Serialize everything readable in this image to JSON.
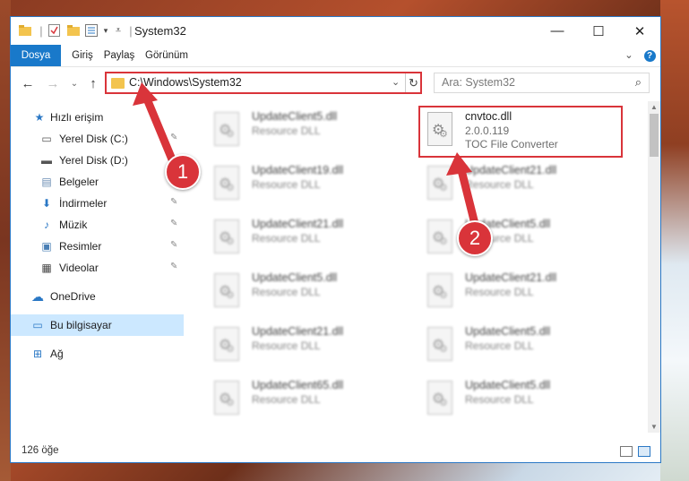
{
  "window": {
    "title": "System32",
    "quick_access_toolbar": [
      "folder-icon",
      "properties-icon",
      "new-folder-icon",
      "customize-icon"
    ],
    "controls": {
      "minimize": "—",
      "maximize": "☐",
      "close": "✕"
    }
  },
  "ribbon": {
    "tabs": [
      "Dosya",
      "Giriş",
      "Paylaş",
      "Görünüm"
    ],
    "expand": "⌄",
    "help": "?"
  },
  "navigation": {
    "back": "←",
    "forward": "→",
    "recent": "⌄",
    "up": "↑",
    "address": "C:\\Windows\\System32",
    "dropdown": "⌄",
    "refresh": "↻",
    "search_placeholder": "Ara: System32",
    "search_icon": "⌕"
  },
  "sidebar": {
    "items": [
      {
        "label": "Hızlı erişim",
        "icon": "star-icon",
        "glyph": "★",
        "pinned": false
      },
      {
        "label": "Yerel Disk (C:)",
        "icon": "drive-icon",
        "glyph": "▭",
        "pinned": true
      },
      {
        "label": "Yerel Disk (D:)",
        "icon": "drive-icon",
        "glyph": "▬",
        "pinned": true
      },
      {
        "label": "Belgeler",
        "icon": "documents-icon",
        "glyph": "▤",
        "pinned": true
      },
      {
        "label": "İndirmeler",
        "icon": "downloads-icon",
        "glyph": "⬇",
        "pinned": true
      },
      {
        "label": "Müzik",
        "icon": "music-icon",
        "glyph": "♪",
        "pinned": true
      },
      {
        "label": "Resimler",
        "icon": "pictures-icon",
        "glyph": "▣",
        "pinned": true
      },
      {
        "label": "Videolar",
        "icon": "videos-icon",
        "glyph": "▦",
        "pinned": true
      },
      {
        "label": "OneDrive",
        "icon": "cloud-icon",
        "glyph": "☁",
        "pinned": false
      },
      {
        "label": "Bu bilgisayar",
        "icon": "computer-icon",
        "glyph": "▭",
        "pinned": false,
        "selected": true
      },
      {
        "label": "Ağ",
        "icon": "network-icon",
        "glyph": "⊞",
        "pinned": false
      }
    ],
    "pin_glyph": "✎"
  },
  "files": [
    {
      "name": "UpdateClient5.dll",
      "line2": "Resource DLL",
      "line3": ""
    },
    {
      "name": "cnvtoc.dll",
      "line2": "2.0.0.119",
      "line3": "TOC File Converter"
    },
    {
      "name": "UpdateClient19.dll",
      "line2": "Resource DLL",
      "line3": ""
    },
    {
      "name": "UpdateClient21.dll",
      "line2": "Resource DLL",
      "line3": ""
    },
    {
      "name": "UpdateClient21.dll",
      "line2": "Resource DLL",
      "line3": ""
    },
    {
      "name": "UpdateClient5.dll",
      "line2": "Resource DLL",
      "line3": ""
    },
    {
      "name": "UpdateClient5.dll",
      "line2": "Resource DLL",
      "line3": ""
    },
    {
      "name": "UpdateClient21.dll",
      "line2": "Resource DLL",
      "line3": ""
    },
    {
      "name": "UpdateClient21.dll",
      "line2": "Resource DLL",
      "line3": ""
    },
    {
      "name": "UpdateClient5.dll",
      "line2": "Resource DLL",
      "line3": ""
    },
    {
      "name": "UpdateClient65.dll",
      "line2": "Resource DLL",
      "line3": ""
    },
    {
      "name": "UpdateClient5.dll",
      "line2": "Resource DLL",
      "line3": ""
    }
  ],
  "status": {
    "count": "126 öğe"
  },
  "annotations": {
    "callout1": "1",
    "callout2": "2",
    "color": "#d9343a"
  },
  "colors": {
    "accent": "#1979ca",
    "selection": "#cce8ff",
    "highlight": "#d9343a"
  }
}
